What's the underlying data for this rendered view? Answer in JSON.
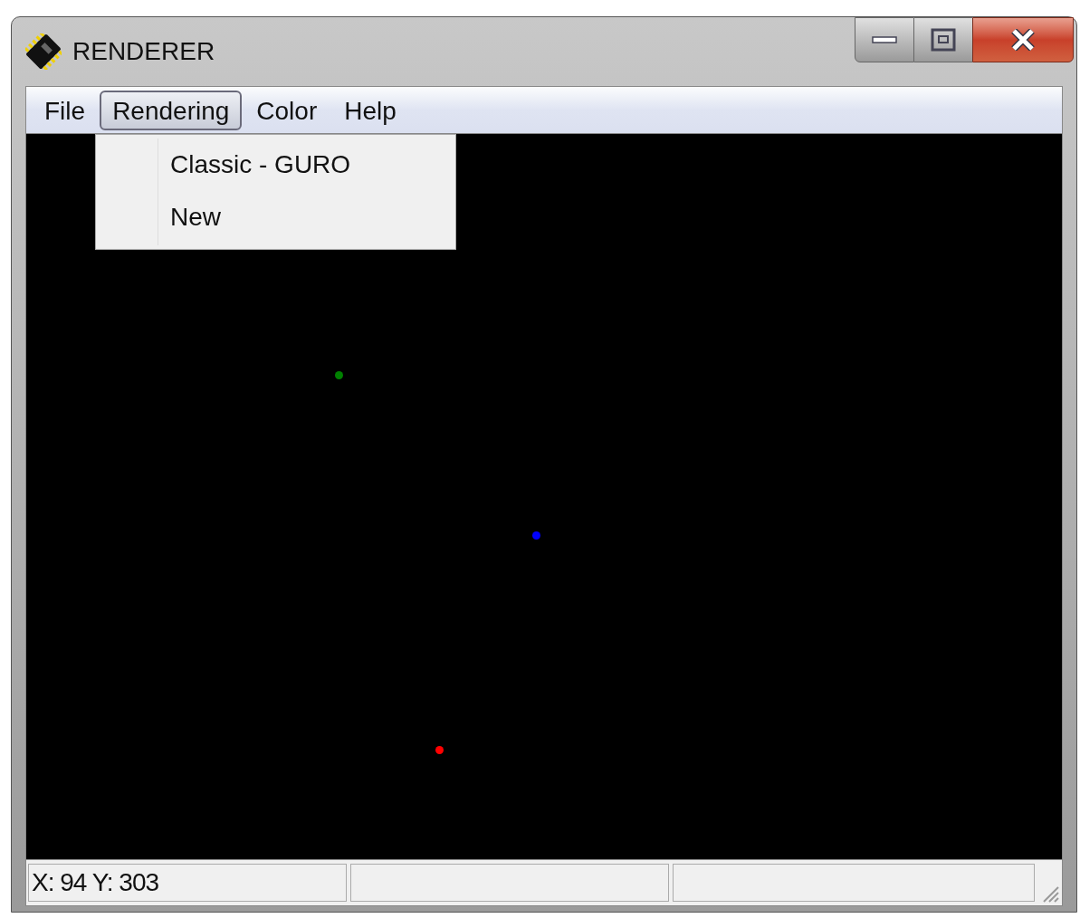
{
  "window": {
    "title": "RENDERER"
  },
  "menu": [
    {
      "label": "File",
      "selected": false
    },
    {
      "label": "Rendering",
      "selected": true
    },
    {
      "label": "Color",
      "selected": false
    },
    {
      "label": "Help",
      "selected": false
    }
  ],
  "dropdown": {
    "items": [
      {
        "label": "Classic - GURO"
      },
      {
        "label": "New"
      }
    ]
  },
  "canvas": {
    "points": [
      {
        "color": "#008000"
      },
      {
        "color": "#0000ff"
      },
      {
        "color": "#ff0000"
      }
    ]
  },
  "status_bar": {
    "panes": [
      "X: 94 Y: 303"
    ]
  }
}
